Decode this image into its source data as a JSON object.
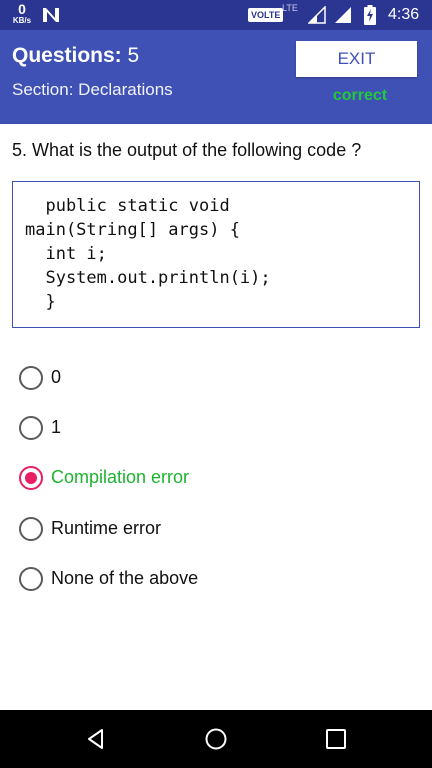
{
  "status_bar": {
    "speed_value": "0",
    "speed_unit": "KB/s",
    "volte": "VOLTE",
    "lte": "LTE",
    "time": "4:36",
    "icons": [
      "n-notification-icon",
      "volte-badge",
      "signal-icon",
      "battery-charging-icon"
    ]
  },
  "header": {
    "questions_label": "Questions:",
    "questions_value": "5",
    "section_label": "Section:",
    "section_value": "Declarations",
    "exit_label": "EXIT",
    "result": "correct"
  },
  "question": {
    "text": "5. What is the output of the following code ?",
    "code_lines": [
      "  public static void",
      "main(String[] args) {",
      "  int i;",
      "  System.out.println(i);",
      "  }"
    ]
  },
  "options": [
    {
      "label": "0",
      "selected": false,
      "correct": false
    },
    {
      "label": "1",
      "selected": false,
      "correct": false
    },
    {
      "label": "Compilation error",
      "selected": true,
      "correct": true
    },
    {
      "label": "Runtime error",
      "selected": false,
      "correct": false
    },
    {
      "label": "None of the above",
      "selected": false,
      "correct": false
    }
  ],
  "nav_bar": {
    "icons": [
      "back-icon",
      "home-icon",
      "recents-icon"
    ]
  },
  "colors": {
    "status_bar": "#2b3592",
    "header": "#3f51b5",
    "correct_text": "#22c93a",
    "selected_radio": "#e91e63",
    "code_border": "#3f51b5"
  }
}
